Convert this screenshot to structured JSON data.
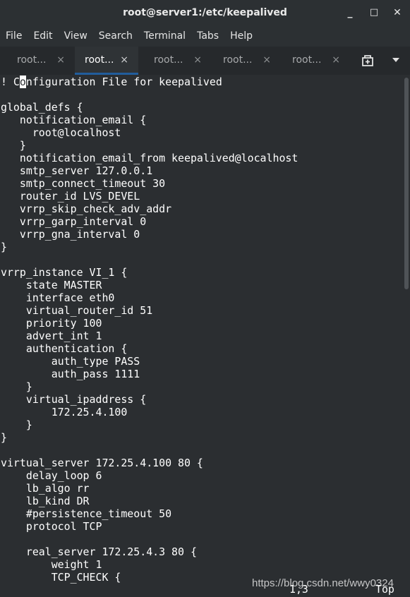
{
  "window": {
    "title": "root@server1:/etc/keepalived",
    "minimize_glyph": "_",
    "maximize_glyph": "□",
    "close_glyph": "✕"
  },
  "menu": [
    "File",
    "Edit",
    "View",
    "Search",
    "Terminal",
    "Tabs",
    "Help"
  ],
  "tabs": [
    {
      "label": "root...",
      "active": false
    },
    {
      "label": "root...",
      "active": true
    },
    {
      "label": "root...",
      "active": false
    },
    {
      "label": "root...",
      "active": false
    },
    {
      "label": "root...",
      "active": false
    }
  ],
  "tab_close_glyph": "×",
  "icons": {
    "new_tab": "new-tab-icon",
    "tabs_menu": "chevron-down-icon"
  },
  "colors": {
    "terminal_bg": "#2b2e31",
    "terminal_fg": "#ffffff",
    "active_tab_underline": "#215d9c"
  },
  "terminal": {
    "cursor": {
      "line": 0,
      "before": "! C",
      "char": "o",
      "after": "nfiguration File for keepalived"
    },
    "lines": [
      "! Configuration File for keepalived",
      "",
      "global_defs {",
      "   notification_email {",
      "     root@localhost",
      "   }",
      "   notification_email_from keepalived@localhost",
      "   smtp_server 127.0.0.1",
      "   smtp_connect_timeout 30",
      "   router_id LVS_DEVEL",
      "   vrrp_skip_check_adv_addr",
      "   vrrp_garp_interval 0",
      "   vrrp_gna_interval 0",
      "}",
      "",
      "vrrp_instance VI_1 {",
      "    state MASTER",
      "    interface eth0",
      "    virtual_router_id 51",
      "    priority 100",
      "    advert_int 1",
      "    authentication {",
      "        auth_type PASS",
      "        auth_pass 1111",
      "    }",
      "    virtual_ipaddress {",
      "        172.25.4.100",
      "    }",
      "}",
      "",
      "virtual_server 172.25.4.100 80 {",
      "    delay_loop 6",
      "    lb_algo rr",
      "    lb_kind DR",
      "    #persistence_timeout 50",
      "    protocol TCP",
      "",
      "    real_server 172.25.4.3 80 {",
      "        weight 1",
      "        TCP_CHECK {"
    ],
    "status_position": "1,3",
    "status_scroll": "Top"
  },
  "watermark": "https://blog.csdn.net/wwy0324"
}
